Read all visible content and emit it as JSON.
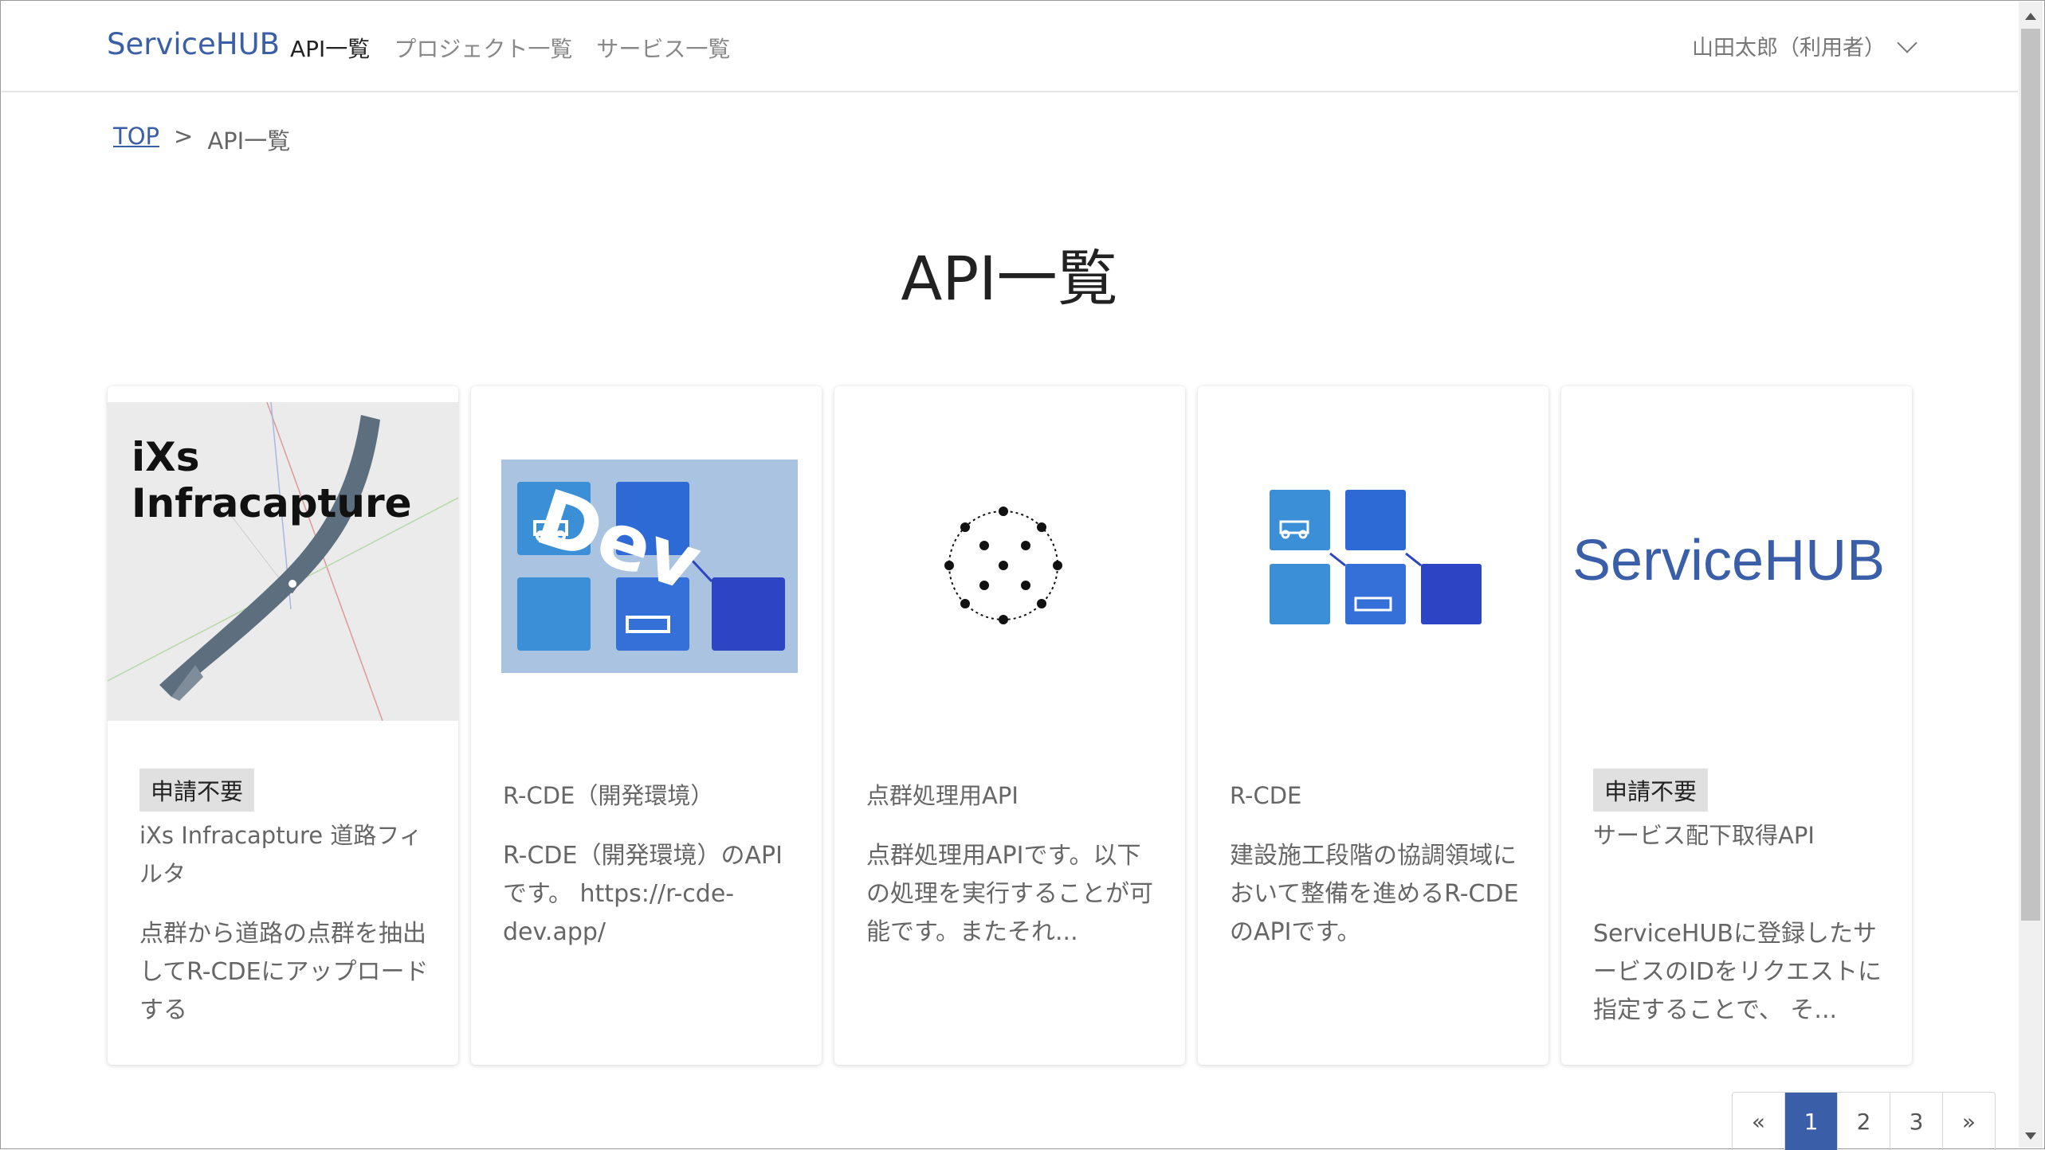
{
  "header": {
    "brand": "ServiceHUB",
    "nav": [
      "API一覧",
      "プロジェクト一覧",
      "サービス一覧"
    ],
    "user": "山田太郎（利用者）"
  },
  "breadcrumb": {
    "top": "TOP",
    "separator": ">",
    "current": "API一覧"
  },
  "page_title": "API一覧",
  "cards": [
    {
      "image_text": "iXs Infracapture",
      "badge": "申請不要",
      "title": "iXs Infracapture 道路フィルタ",
      "desc": "点群から道路の点群を抽出してR-CDEにアップロードする"
    },
    {
      "image_text": "Dev",
      "badge": "",
      "title": "R-CDE（開発環境）",
      "desc": "R-CDE（開発環境）のAPIです。 https://r-cde-dev.app/"
    },
    {
      "image_text": "",
      "badge": "",
      "title": "点群処理用API",
      "desc": "点群処理用APIです。以下の処理を実行することが可能です。またそれ..."
    },
    {
      "image_text": "",
      "badge": "",
      "title": "R-CDE",
      "desc": "建設施工段階の協調領域において整備を進めるR-CDEのAPIです。"
    },
    {
      "image_text": "ServiceHUB",
      "badge": "申請不要",
      "title": "サービス配下取得API",
      "desc": "ServiceHUBに登録したサービスのIDをリクエストに指定することで、 そ..."
    }
  ],
  "pagination": {
    "prev": "«",
    "pages": [
      "1",
      "2",
      "3"
    ],
    "next": "»",
    "current": "1"
  },
  "colors": {
    "brand": "#3b5ea8",
    "tile_light": "#3a8fd6",
    "tile_dark": "#2b45c4"
  }
}
